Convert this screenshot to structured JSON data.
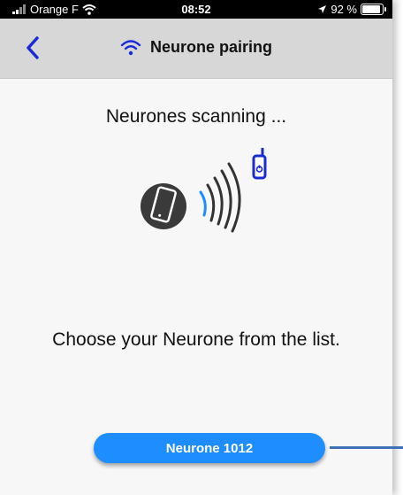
{
  "status_bar": {
    "carrier": "Orange F",
    "time": "08:52",
    "battery_percent": "92 %",
    "battery_level": 0.92
  },
  "header": {
    "title": "Neurone pairing"
  },
  "main": {
    "scanning_text": "Neurones scanning ...",
    "instruction_text": "Choose your Neurone from the list.",
    "devices": [
      {
        "label": "Neurone 1012"
      }
    ]
  },
  "colors": {
    "accent": "#1e8dff",
    "nav_bg": "#d7d7d7",
    "back_arrow": "#1a2bd6",
    "wifi_icon": "#1a2bd6"
  },
  "icons": [
    "signal-bars-icon",
    "wifi-icon",
    "location-arrow-icon",
    "battery-icon",
    "chevron-left-icon",
    "phone-icon",
    "radio-waves-icon",
    "remote-device-icon"
  ]
}
